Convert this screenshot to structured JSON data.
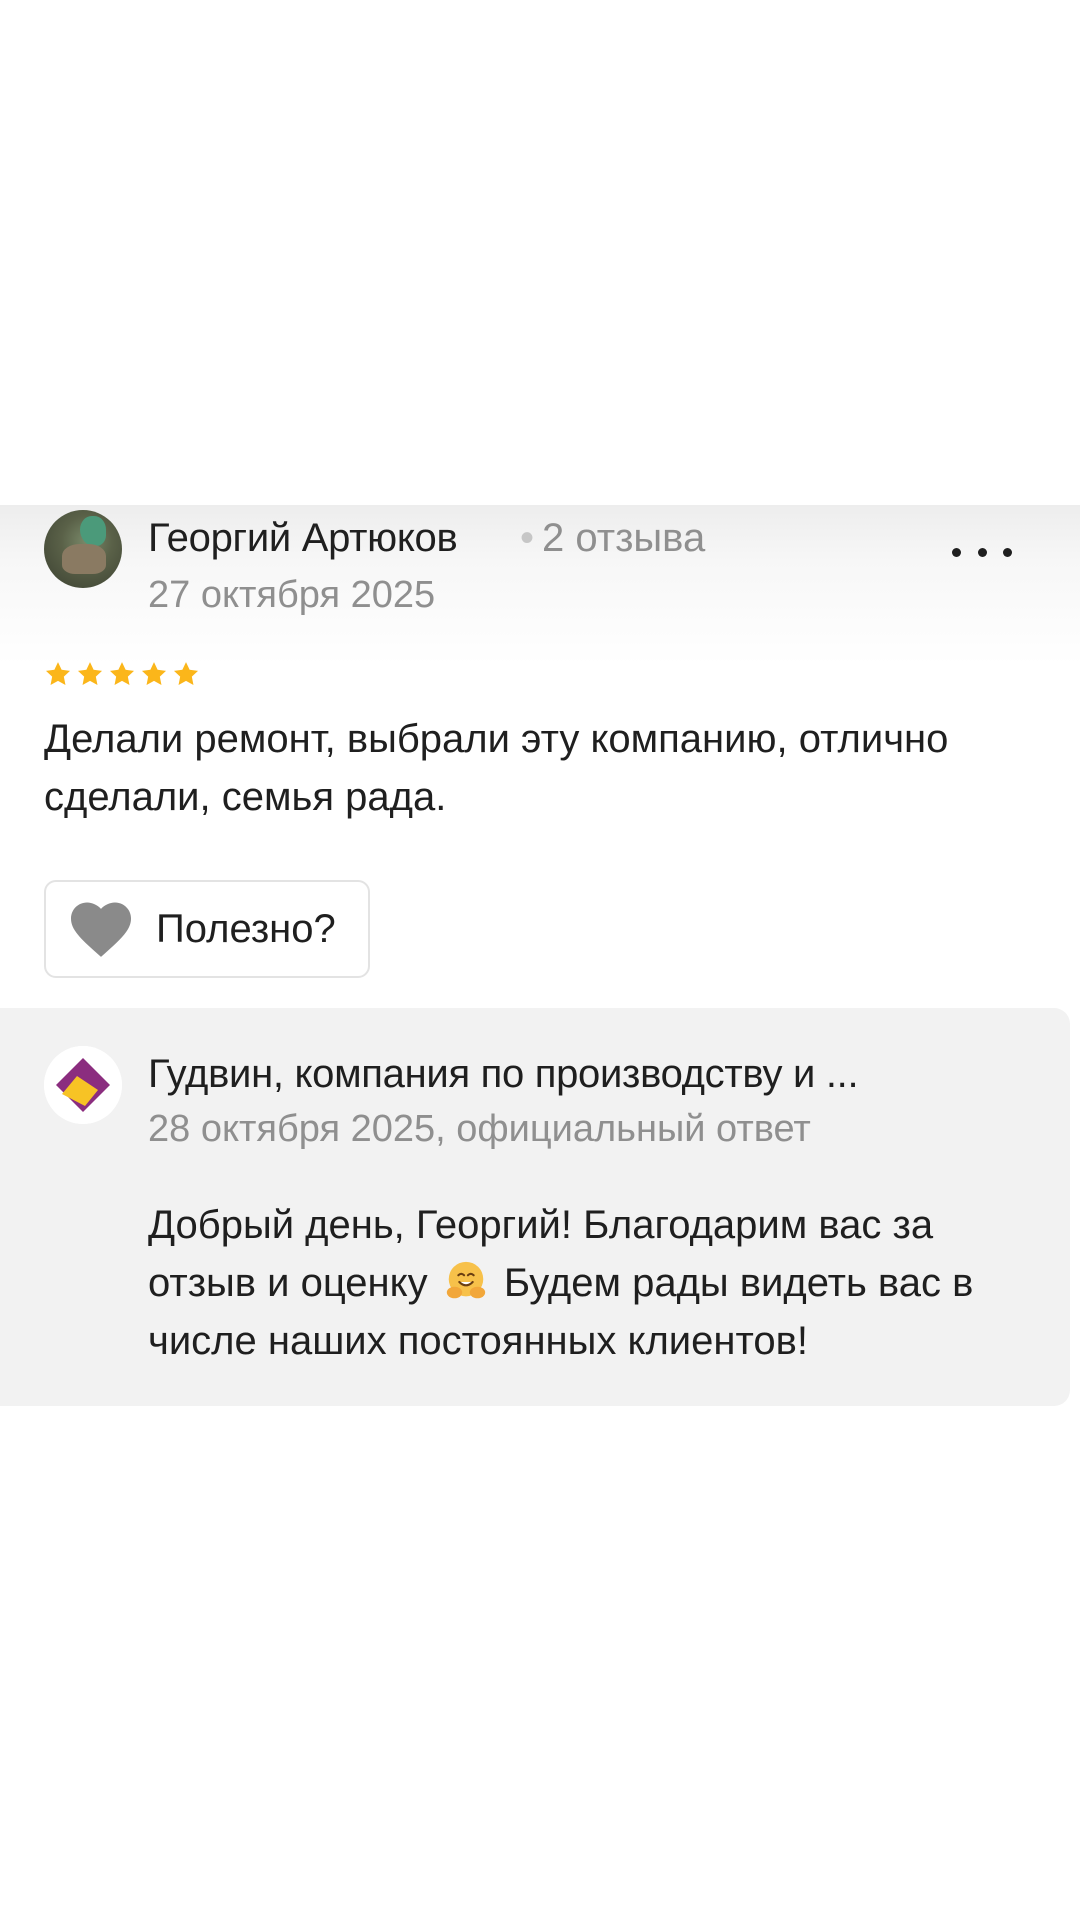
{
  "review": {
    "author_name": "Георгий Артюков",
    "author_reviews_count": "2 отзыва",
    "date": "27 октября 2025",
    "rating": 5,
    "text": "Делали ремонт, выбрали эту компанию, отлично сделали, семья рада.",
    "useful_label": "Полезно?",
    "more_icon": "more-horizontal-icon",
    "colors": {
      "star": "#fbb61a",
      "heart": "#8a8a8a",
      "reply_background": "#f2f2f2"
    }
  },
  "reply": {
    "company_name": "Гудвин, компания по производству и ...",
    "meta": "28 октября 2025, официальный ответ",
    "text_part1": "Добрый день, Георгий! Благодарим вас за отзыв и оценку",
    "emoji": "hugging-face-emoji",
    "text_part2": "Будем рады видеть вас в числе наших постоянных клиентов!",
    "logo_colors": [
      "#8b2d7f",
      "#f7c325"
    ]
  }
}
